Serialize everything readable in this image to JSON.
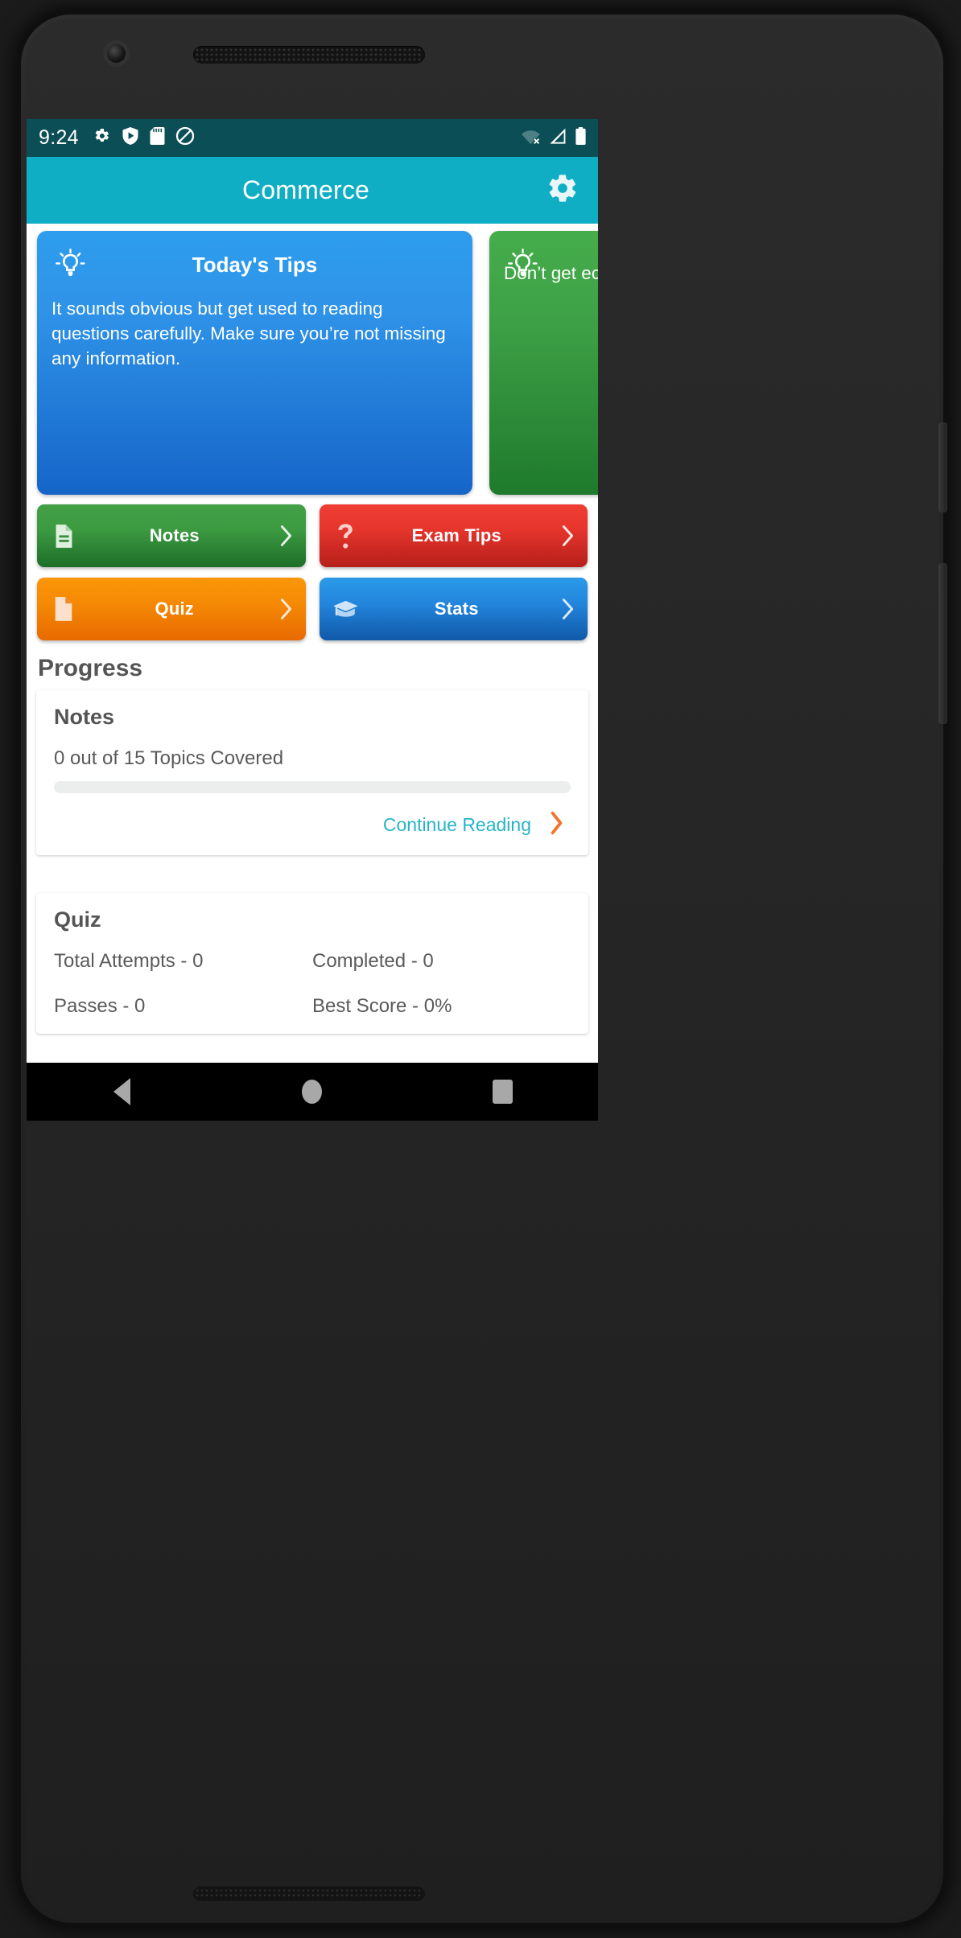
{
  "status_bar": {
    "time": "9:24",
    "left_icons": [
      "gear-icon",
      "shield-play-icon",
      "sd-card-icon",
      "do-not-disturb-icon"
    ],
    "right_icons": [
      "wifi-off-icon",
      "cellular-signal-icon",
      "battery-full-icon"
    ]
  },
  "app_bar": {
    "title": "Commerce",
    "action_icon": "gear-icon"
  },
  "tips": {
    "cards": [
      {
        "icon": "lightbulb-icon",
        "title": "Today's Tips",
        "body": "It sounds obvious but get used to reading questions carefully. Make sure you’re not missing any information.",
        "color": "#2e9ded"
      },
      {
        "icon": "lightbulb-icon",
        "title": "",
        "body": "Don’t get ec each s",
        "color": "#45ad4b"
      }
    ]
  },
  "nav_buttons": [
    {
      "label": "Notes",
      "icon": "document-lines-icon",
      "chevron": "chevron-right-icon",
      "color": "#43a047"
    },
    {
      "label": "Exam Tips",
      "icon": "question-mark-icon",
      "chevron": "chevron-right-icon",
      "color": "#ef3e34"
    },
    {
      "label": "Quiz",
      "icon": "page-icon",
      "chevron": "chevron-right-icon",
      "color": "#fb9608"
    },
    {
      "label": "Stats",
      "icon": "graduation-cap-icon",
      "chevron": "chevron-right-icon",
      "color": "#2b9ae8"
    }
  ],
  "progress": {
    "heading": "Progress",
    "notes_card": {
      "title": "Notes",
      "subtitle": "0 out of 15 Topics Covered",
      "percent": 0,
      "action_label": "Continue Reading",
      "action_icon": "chevron-right-icon",
      "action_color": "#26b4c8",
      "chevron_color": "#f4722b"
    },
    "quiz_card": {
      "title": "Quiz",
      "stats": [
        "Total Attempts - 0",
        "Completed - 0",
        "Passes - 0",
        "Best Score - 0%"
      ]
    }
  },
  "android_nav": {
    "back": "back-nav-icon",
    "home": "home-nav-icon",
    "recents": "recents-nav-icon"
  }
}
